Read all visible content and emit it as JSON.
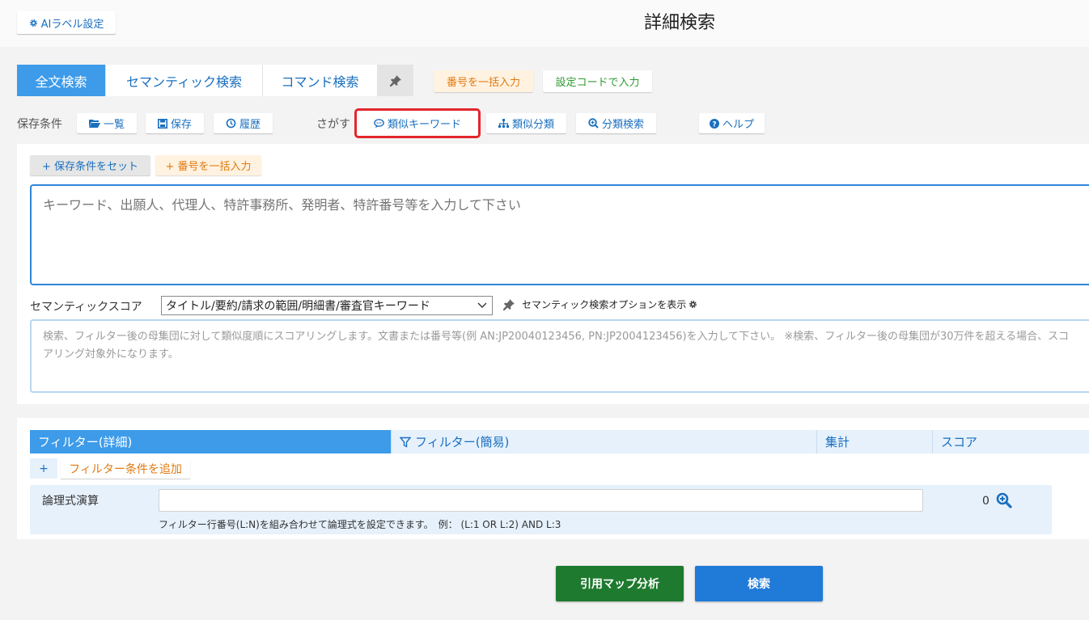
{
  "header": {
    "ai_label_button": "AIラベル設定",
    "title": "詳細検索"
  },
  "tabs": [
    {
      "label": "全文検索",
      "active": true
    },
    {
      "label": "セマンティック検索",
      "active": false
    },
    {
      "label": "コマンド検索",
      "active": false
    }
  ],
  "top_actions": {
    "bulk_number": "番号を一括入力",
    "setting_code": "設定コードで入力"
  },
  "saved_conditions": {
    "label": "保存条件",
    "list": "一覧",
    "save": "保存",
    "history": "履歴"
  },
  "find": {
    "label": "さがす",
    "similar_keyword": "類似キーワード",
    "similar_class": "類似分類",
    "class_search": "分類検索",
    "help": "ヘルプ"
  },
  "keyword_panel": {
    "set_saved": "+ 保存条件をセット",
    "bulk_number": "+ 番号を一括入力",
    "placeholder": "キーワード、出願人、代理人、特許事務所、発明者、特許番号等を入力して下さい"
  },
  "semantic": {
    "label": "セマンティックスコア",
    "selected": "タイトル/要約/請求の範囲/明細書/審査官キーワード",
    "show_options": "セマンティック検索オプションを表示",
    "placeholder": "検索、フィルター後の母集団に対して類似度順にスコアリングします。文書または番号等(例 AN:JP20040123456, PN:JP2004123456)を入力して下さい。 ※検索、フィルター後の母集団が30万件を超える場合、スコアリング対象外になります。"
  },
  "filter_tabs": [
    {
      "label": "フィルター(詳細)",
      "active": true
    },
    {
      "label": "フィルター(簡易)",
      "active": false
    },
    {
      "label": "集計",
      "active": false
    },
    {
      "label": "スコア",
      "active": false
    }
  ],
  "filter": {
    "plus": "+",
    "add_condition": "フィルター条件を追加",
    "logic_label": "論理式演算",
    "logic_hint": "フィルター行番号(L:N)を組み合わせて論理式を設定できます。　例：  (L:1 OR L:2) AND L:3",
    "count": "0"
  },
  "bottom": {
    "citation_map": "引用マップ分析",
    "search": "検索"
  },
  "colors": {
    "accent": "#3d9be9",
    "highlight": "#e3262b",
    "green": "#1e7a2e",
    "search_blue": "#1f7ad8"
  }
}
